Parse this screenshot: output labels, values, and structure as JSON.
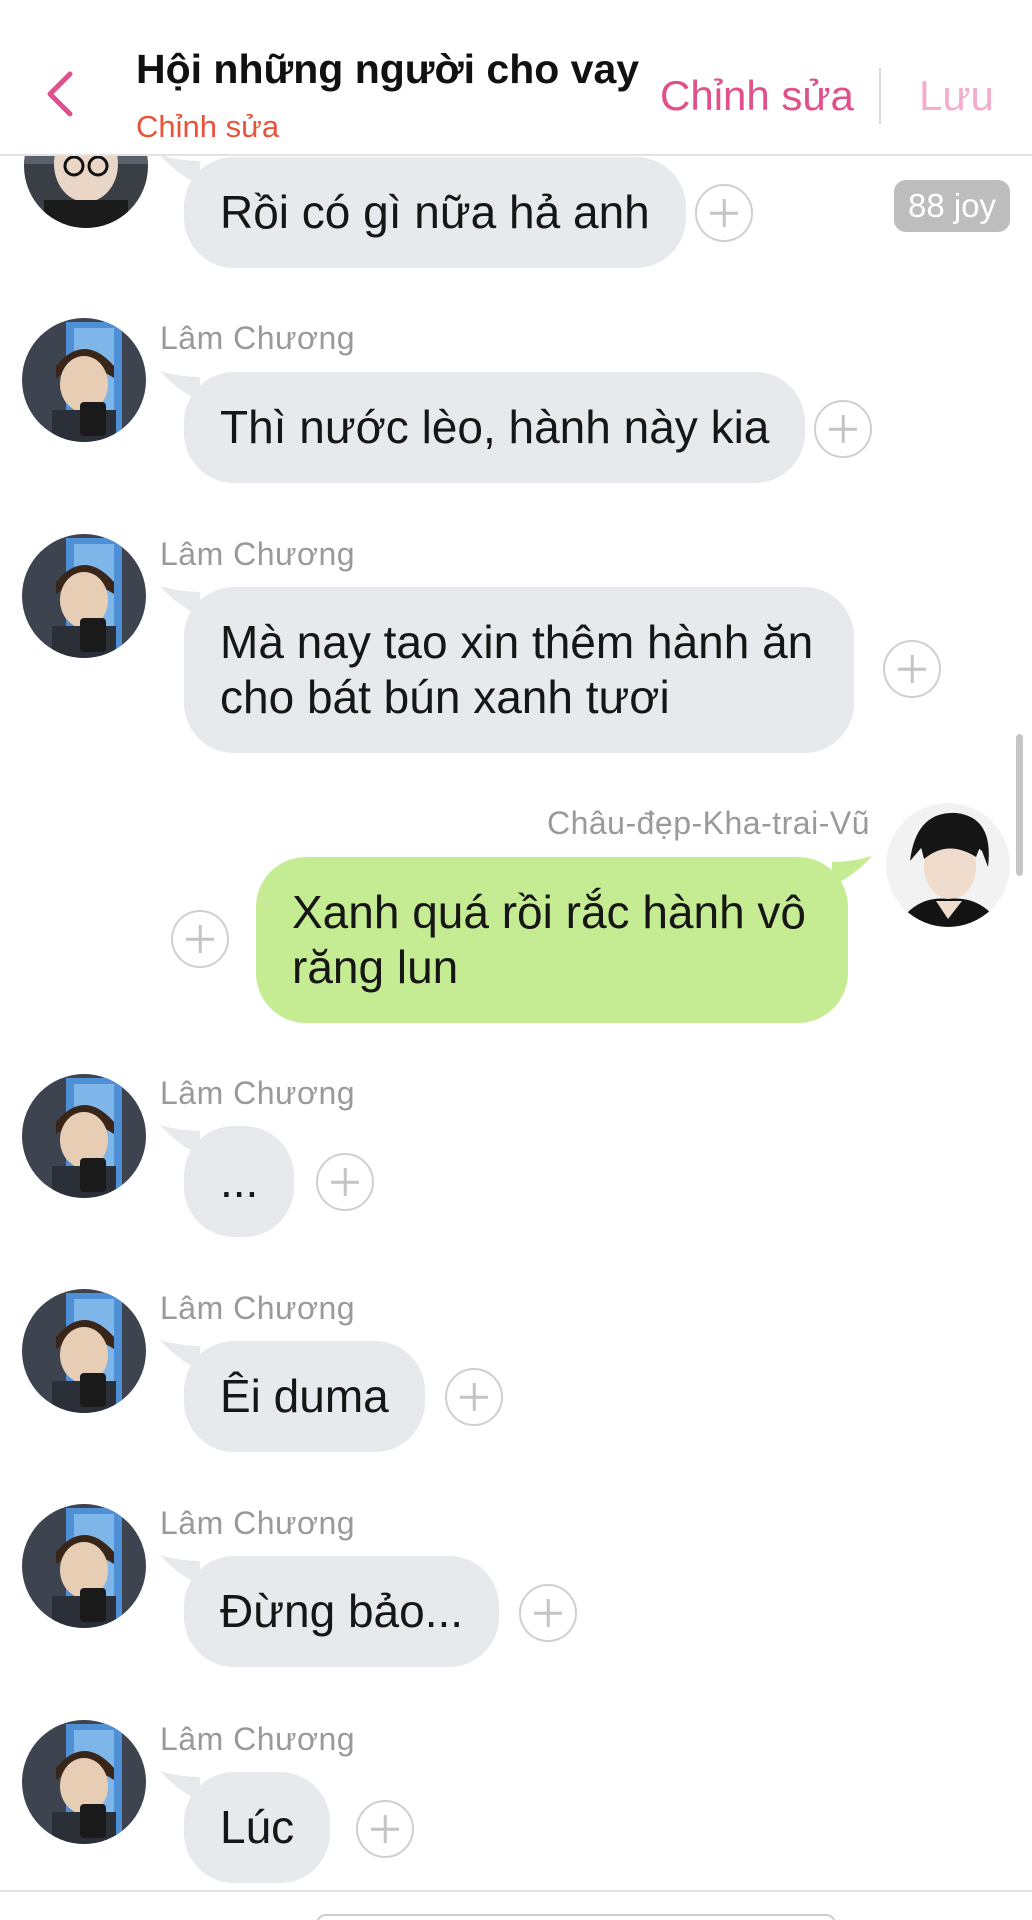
{
  "header": {
    "title": "Hội những người cho vay",
    "subtitle": "Chỉnh sửa",
    "edit_label": "Chỉnh sửa",
    "save_label": "Lưu"
  },
  "badge": {
    "joy": "88 joy"
  },
  "messages": [
    {
      "sender": "",
      "text": "Rồi có gì nữa hả anh",
      "side": "left"
    },
    {
      "sender": "Lâm Chương",
      "text": "Thì nước lèo, hành này kia",
      "side": "left"
    },
    {
      "sender": "Lâm Chương",
      "text": "Mà nay tao xin thêm hành ăn\ncho bát bún xanh tươi",
      "side": "left"
    },
    {
      "sender": "Châu-đẹp-Kha-trai-Vũ",
      "text": "Xanh quá rồi rắc hành vô\nrăng lun",
      "side": "right"
    },
    {
      "sender": "Lâm Chương",
      "text": "...",
      "side": "left"
    },
    {
      "sender": "Lâm Chương",
      "text": "Êi duma",
      "side": "left"
    },
    {
      "sender": "Lâm Chương",
      "text": "Đừng bảo...",
      "side": "left"
    },
    {
      "sender": "Lâm Chương",
      "text": "Lúc",
      "side": "left"
    }
  ],
  "colors": {
    "accent": "#e0508a",
    "subtitle": "#e8543a",
    "incoming_bubble": "#e7e9ec",
    "outgoing_bubble": "#c6ec93"
  }
}
